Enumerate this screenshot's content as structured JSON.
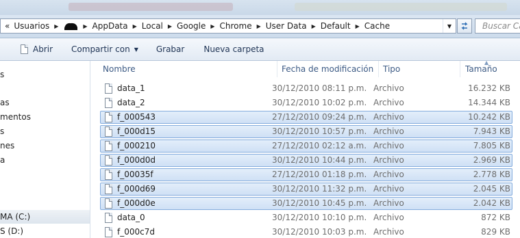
{
  "address_bar": {
    "overflow_glyph": "«",
    "crumbs": [
      "Usuarios",
      "",
      "AppData",
      "Local",
      "Google",
      "Chrome",
      "User Data",
      "Default",
      "Cache"
    ],
    "search_placeholder": "Buscar Cac"
  },
  "toolbar": {
    "open_label": "Abrir",
    "share_label": "Compartir con",
    "record_label": "Grabar",
    "new_folder_label": "Nueva carpeta"
  },
  "nav": {
    "items": [
      "s",
      "as",
      "mentos",
      "s",
      "nes",
      "a",
      "MA (C:)",
      "S (D:)"
    ],
    "selected_index": 6
  },
  "columns": {
    "name": "Nombre",
    "modified": "Fecha de modificación",
    "type": "Tipo",
    "size": "Tamaño"
  },
  "files": [
    {
      "name": "data_1",
      "modified": "30/12/2010 08:11 p.m.",
      "type": "Archivo",
      "size": "16.232 KB",
      "selected": false
    },
    {
      "name": "data_2",
      "modified": "30/12/2010 10:02 p.m.",
      "type": "Archivo",
      "size": "14.344 KB",
      "selected": false
    },
    {
      "name": "f_000543",
      "modified": "27/12/2010 09:24 p.m.",
      "type": "Archivo",
      "size": "10.242 KB",
      "selected": true
    },
    {
      "name": "f_000d15",
      "modified": "30/12/2010 10:57 p.m.",
      "type": "Archivo",
      "size": "7.943 KB",
      "selected": true
    },
    {
      "name": "f_000210",
      "modified": "27/12/2010 02:12 a.m.",
      "type": "Archivo",
      "size": "7.805 KB",
      "selected": true
    },
    {
      "name": "f_000d0d",
      "modified": "30/12/2010 10:44 p.m.",
      "type": "Archivo",
      "size": "2.969 KB",
      "selected": true
    },
    {
      "name": "f_00035f",
      "modified": "27/12/2010 01:18 p.m.",
      "type": "Archivo",
      "size": "2.778 KB",
      "selected": true
    },
    {
      "name": "f_000d69",
      "modified": "30/12/2010 11:32 p.m.",
      "type": "Archivo",
      "size": "2.045 KB",
      "selected": true
    },
    {
      "name": "f_000d0e",
      "modified": "30/12/2010 10:45 p.m.",
      "type": "Archivo",
      "size": "2.042 KB",
      "selected": true
    },
    {
      "name": "data_0",
      "modified": "30/12/2010 10:10 p.m.",
      "type": "Archivo",
      "size": "872 KB",
      "selected": false
    },
    {
      "name": "f_000c7d",
      "modified": "30/12/2010 10:03 p.m.",
      "type": "Archivo",
      "size": "829 KB",
      "selected": false
    }
  ],
  "colors": {
    "selection_fill": "#d9e7f8",
    "selection_border": "#84acdd",
    "header_text": "#3c5a84"
  }
}
